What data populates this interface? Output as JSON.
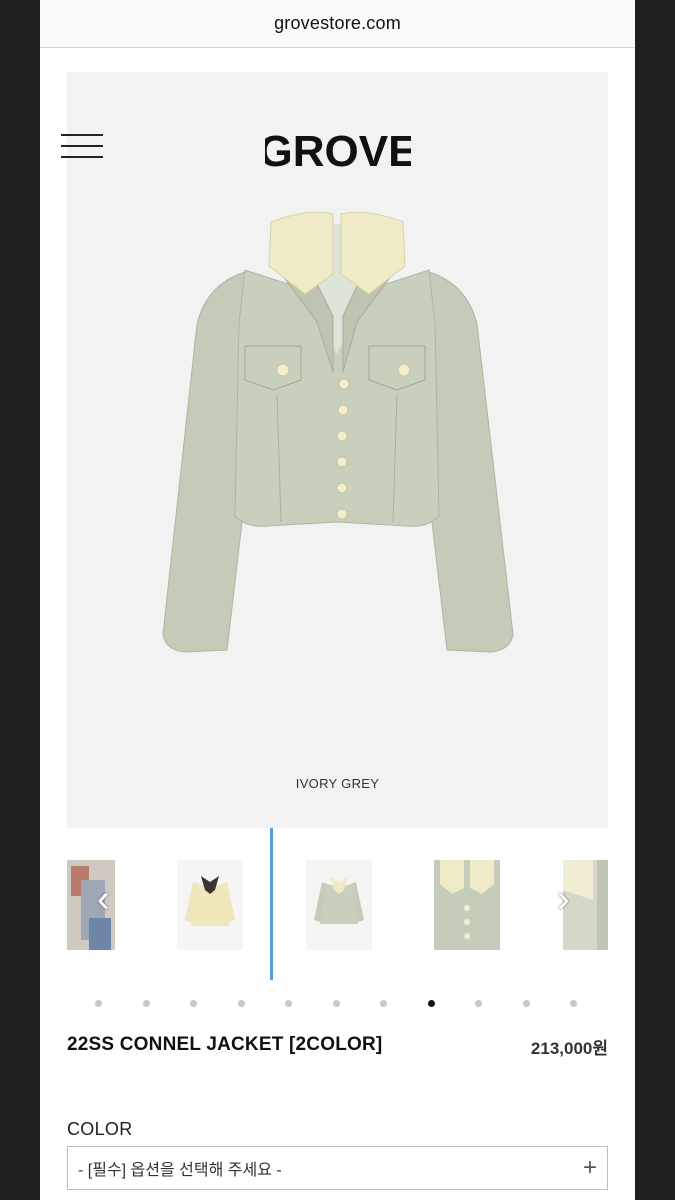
{
  "browser": {
    "url": "grovestore.com"
  },
  "header": {
    "logo_text": "GROVE"
  },
  "hero": {
    "variant_caption": "IVORY GREY"
  },
  "gallery": {
    "slide_count": 11,
    "active_slide": 8
  },
  "product": {
    "title": "22SS CONNEL JACKET [2COLOR]",
    "price": "213,000원"
  },
  "options": {
    "color_label": "COLOR",
    "color_placeholder": "- [필수] 옵션을 선택해 주세요 -",
    "add_symbol": "+"
  },
  "colors": {
    "jacket_body": "#c6cdbb",
    "jacket_collar": "#f1ecc9",
    "hero_background": "#f2f2f2",
    "scroll_indicator": "#5a9bd8"
  },
  "icons": [
    "menu-icon",
    "chevron-left-icon",
    "chevron-right-icon",
    "plus-icon"
  ]
}
